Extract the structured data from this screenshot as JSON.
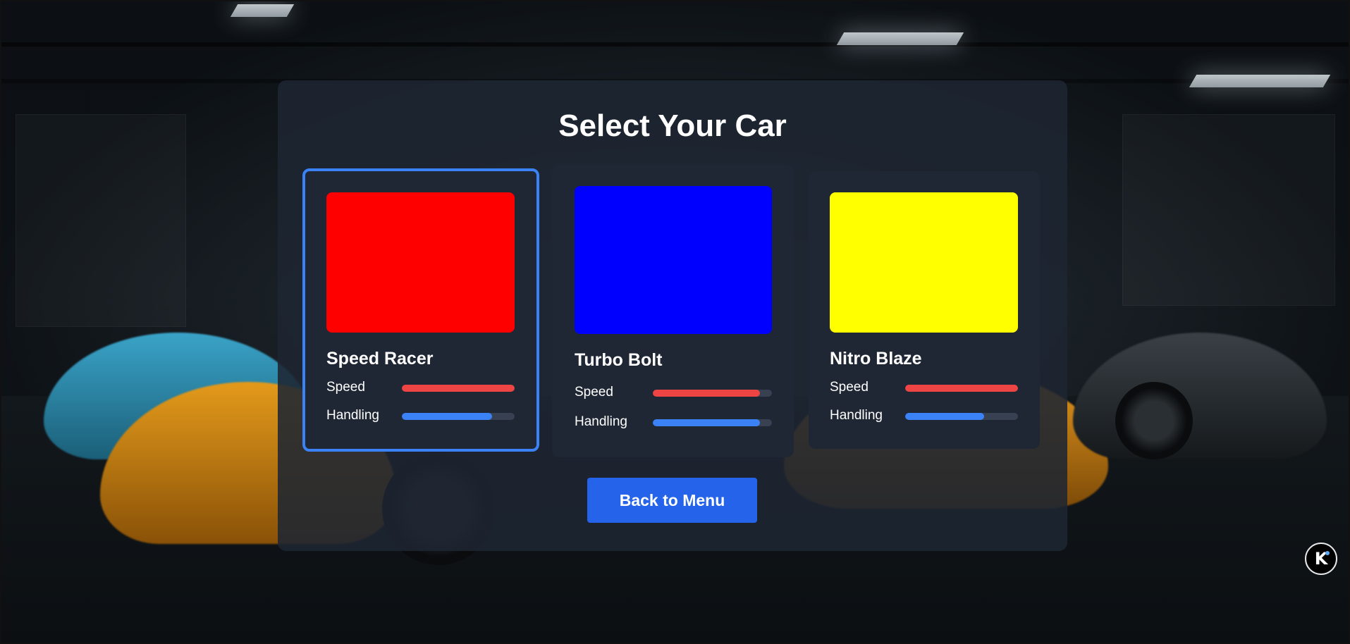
{
  "screen": {
    "title": "Select Your Car",
    "back_button_label": "Back to Menu"
  },
  "cars": [
    {
      "name": "Speed Racer",
      "color": "#ff0000",
      "selected": true,
      "stats": {
        "speed_label": "Speed",
        "speed_value": 1.0,
        "handling_label": "Handling",
        "handling_value": 0.8
      }
    },
    {
      "name": "Turbo Bolt",
      "color": "#0000ff",
      "selected": false,
      "stats": {
        "speed_label": "Speed",
        "speed_value": 0.9,
        "handling_label": "Handling",
        "handling_value": 0.9
      }
    },
    {
      "name": "Nitro Blaze",
      "color": "#ffff00",
      "selected": false,
      "stats": {
        "speed_label": "Speed",
        "speed_value": 1.0,
        "handling_label": "Handling",
        "handling_value": 0.7
      }
    }
  ],
  "colors": {
    "speed_bar": "#ef4444",
    "handling_bar": "#3b82f6",
    "selection_border": "#3b82f6",
    "button": "#2563eb"
  },
  "corner_logo": {
    "icon": "k-logo-icon",
    "letter": "K"
  }
}
